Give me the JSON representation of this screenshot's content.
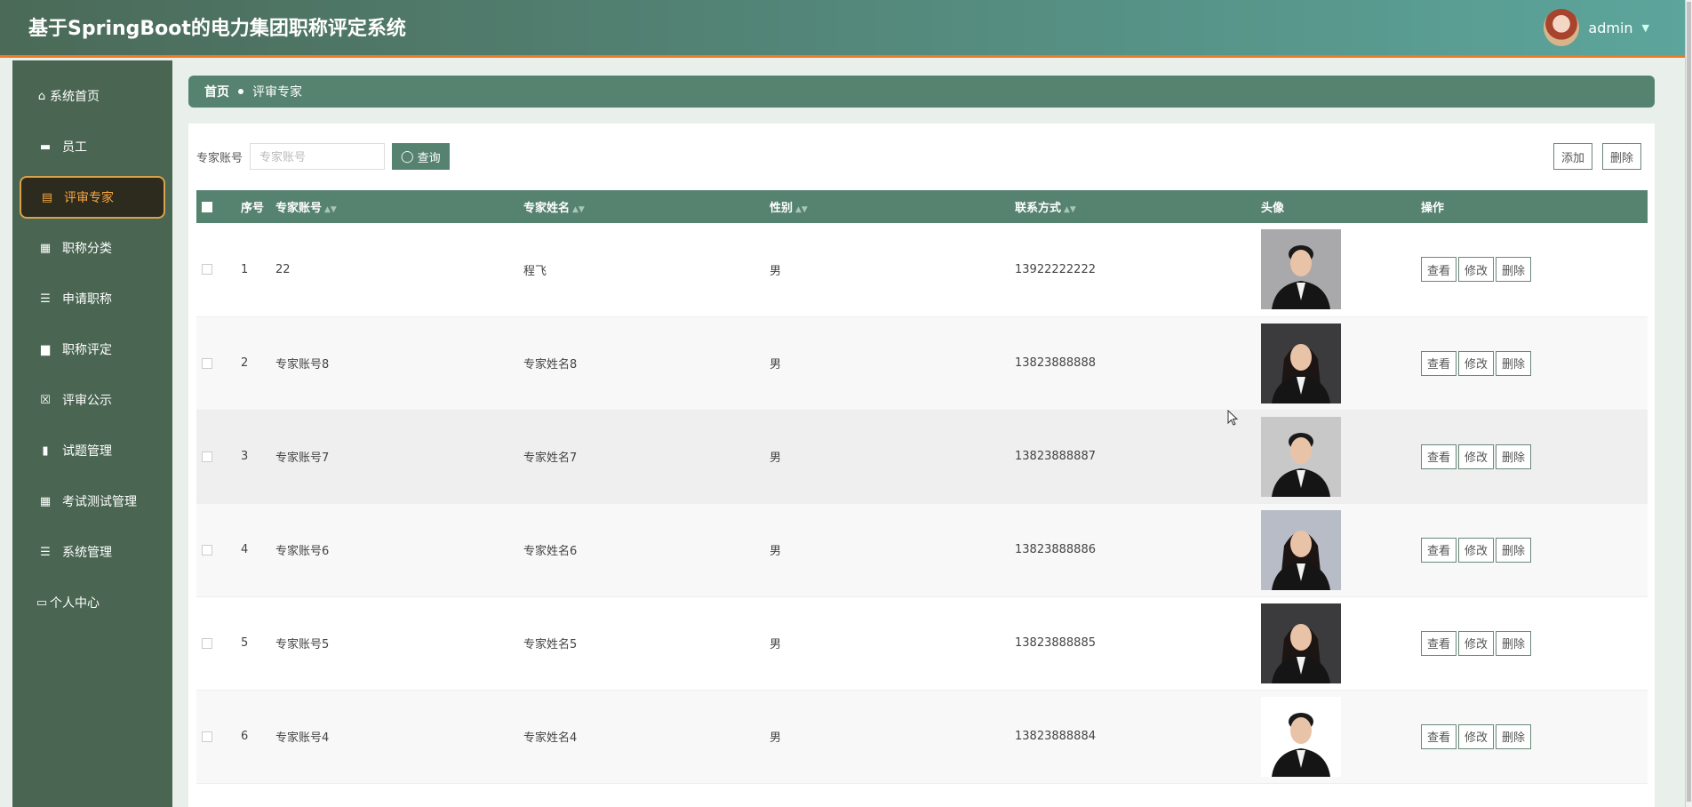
{
  "header": {
    "title": "基于SpringBoot的电力集团职称评定系统",
    "username": "admin"
  },
  "sidebar": {
    "items": [
      {
        "label": "系统首页",
        "icon": "home-icon"
      },
      {
        "label": "员工",
        "icon": "monitor-icon"
      },
      {
        "label": "评审专家",
        "icon": "clipboard-icon",
        "active": true
      },
      {
        "label": "职称分类",
        "icon": "grid-icon"
      },
      {
        "label": "申请职称",
        "icon": "list-icon"
      },
      {
        "label": "职称评定",
        "icon": "briefcase-icon"
      },
      {
        "label": "评审公示",
        "icon": "clipboard-x-icon"
      },
      {
        "label": "试题管理",
        "icon": "book-icon"
      },
      {
        "label": "考试测试管理",
        "icon": "grid-icon"
      },
      {
        "label": "系统管理",
        "icon": "list-icon"
      },
      {
        "label": "个人中心",
        "icon": "card-icon"
      }
    ]
  },
  "breadcrumb": {
    "home": "首页",
    "current": "评审专家"
  },
  "search": {
    "label": "专家账号",
    "placeholder": "专家账号",
    "value": "",
    "button": "查询"
  },
  "toolbar": {
    "add": "添加",
    "delete": "删除"
  },
  "table": {
    "columns": [
      "序号",
      "专家账号",
      "专家姓名",
      "性别",
      "联系方式",
      "头像",
      "操作"
    ],
    "actions": [
      "查看",
      "修改",
      "删除"
    ],
    "rows": [
      {
        "no": "1",
        "account": "22",
        "name": "程飞",
        "gender": "男",
        "phone": "13922222222",
        "photo": "male"
      },
      {
        "no": "2",
        "account": "专家账号8",
        "name": "专家姓名8",
        "gender": "男",
        "phone": "13823888888",
        "photo": "female"
      },
      {
        "no": "3",
        "account": "专家账号7",
        "name": "专家姓名7",
        "gender": "男",
        "phone": "13823888887",
        "photo": "male"
      },
      {
        "no": "4",
        "account": "专家账号6",
        "name": "专家姓名6",
        "gender": "男",
        "phone": "13823888886",
        "photo": "female"
      },
      {
        "no": "5",
        "account": "专家账号5",
        "name": "专家姓名5",
        "gender": "男",
        "phone": "13823888885",
        "photo": "female"
      },
      {
        "no": "6",
        "account": "专家账号4",
        "name": "专家姓名4",
        "gender": "男",
        "phone": "13823888884",
        "photo": "male"
      }
    ]
  }
}
